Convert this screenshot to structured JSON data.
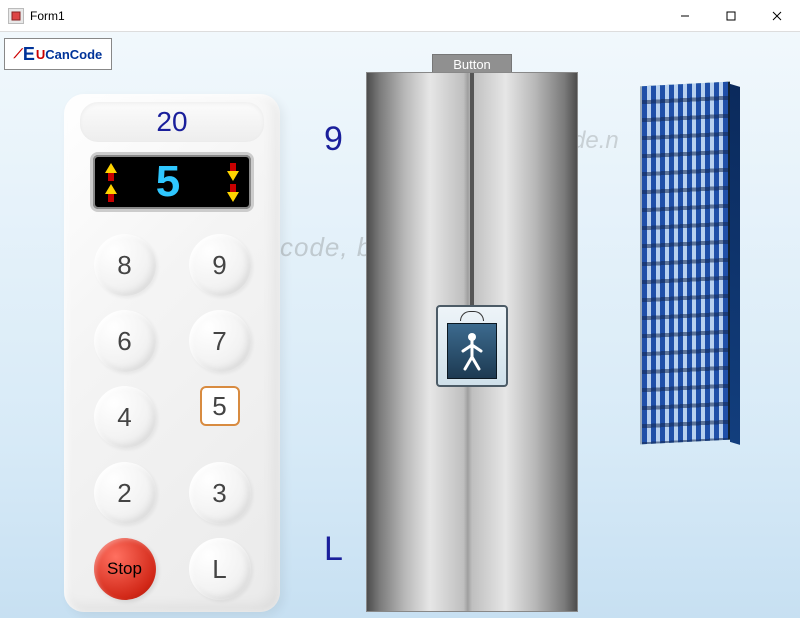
{
  "window": {
    "title": "Form1"
  },
  "logo": {
    "brand_red": "U",
    "brand_blue_e": "E",
    "brand_text": "CanCode"
  },
  "watermark": {
    "line1": "code, by v",
    "line2": "de.n"
  },
  "panel": {
    "top_display": "20",
    "led_floor": "5",
    "buttons": [
      "8",
      "9",
      "6",
      "7",
      "4",
      "5",
      "2",
      "3"
    ],
    "selected_button": "5",
    "stop_label": "Stop",
    "lobby_label": "L"
  },
  "floors": {
    "top": "9",
    "bottom": "L"
  },
  "shaft": {
    "top_button_label": "Button"
  },
  "colors": {
    "accent_blue": "#1a1f9b",
    "led_blue": "#2fc7ff",
    "stop_red": "#d22818"
  }
}
